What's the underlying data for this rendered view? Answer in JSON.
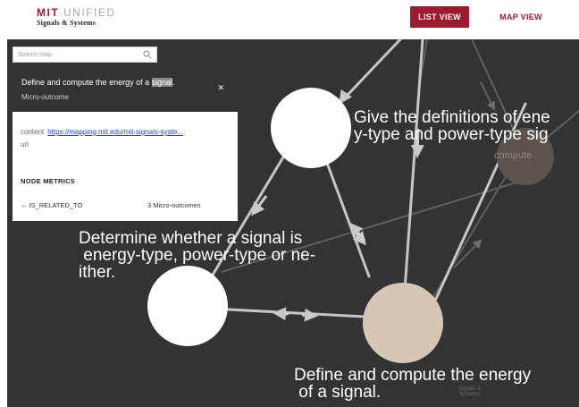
{
  "header": {
    "logo_mit": "MIT",
    "logo_unified": "UNIFIED",
    "logo_subtitle": "Signals & Systems",
    "list_view_label": "LIST VIEW",
    "map_view_label": "MAP VIEW"
  },
  "search": {
    "placeholder": "Search map",
    "value": ""
  },
  "panel": {
    "title_prefix": "Define and compute the energy of a ",
    "title_highlight": "signal",
    "title_suffix": ".",
    "type": "Micro-outcome",
    "content_label": "content",
    "content_link": "https://mapping.mit.edu/mit-signals-syste...",
    "url_label": "url",
    "metrics_title": "NODE METRICS",
    "metric_arrow": "↔",
    "metric_name": "IS_RELATED_TO",
    "metric_value": "3 Micro-outcomes"
  },
  "map": {
    "labels": {
      "node_definitions": "Give the definitions of ene\ny-type and power-type sig",
      "node_determine": "Determine whether a signal is\n energy-type, power-type or ne-\nither.",
      "node_define": "Define and compute the energy\n of a signal.",
      "faded_node": "compute",
      "faded_small": "Signals &\nSystems"
    }
  },
  "colors": {
    "brand": "#9b1b2f",
    "map_background": "#333333",
    "selected_node": "#d7c6b6"
  }
}
